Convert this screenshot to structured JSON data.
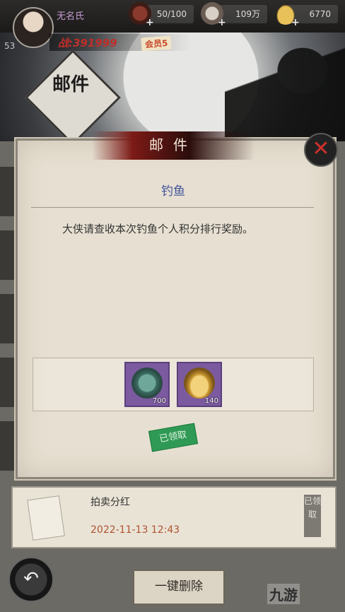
{
  "player": {
    "name": "无名氏",
    "level": "53",
    "power_label": "战:391999",
    "vip_label": "会员5"
  },
  "resources": [
    {
      "icon": "stamina-icon",
      "value": "50/100"
    },
    {
      "icon": "coin-pouch-icon",
      "value": "109万"
    },
    {
      "icon": "gold-ingot-icon",
      "value": "6770"
    }
  ],
  "page_title": "邮件",
  "panel": {
    "title": "邮件",
    "subject": "钓鱼",
    "body": "大侠请查收本次钓鱼个人积分排行奖励。",
    "rewards": [
      {
        "icon": "jade-medal-icon",
        "qty": "700"
      },
      {
        "icon": "gold-ingot-icon",
        "qty": "140"
      }
    ],
    "claimed_stamp": "已领取"
  },
  "mail_list": [
    {
      "title": "拍卖分红",
      "date": "2022-11-13 12:43",
      "status": "已领取"
    }
  ],
  "buttons": {
    "delete_all": "一键删除"
  },
  "watermark": "九游",
  "colors": {
    "subject": "#43549c",
    "date": "#b0532f",
    "stamp": "#2f9a55",
    "power": "#c02e2a",
    "player_name": "#c79dd5"
  }
}
